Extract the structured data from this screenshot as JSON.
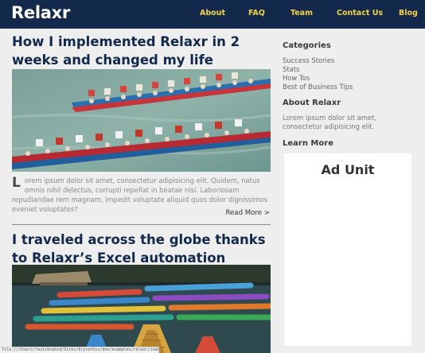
{
  "site": {
    "logo": "Relaxr"
  },
  "nav": {
    "items": [
      "About",
      "FAQ",
      "Team",
      "Contact Us",
      "Blog"
    ]
  },
  "posts": [
    {
      "title": "How I implemented Relaxr in 2 weeks and changed my life",
      "image": "dragon-boat-race-photo",
      "excerpt_first_letter": "L",
      "excerpt_rest": "orem ipsum dolor sit amet, consectetur adipisicing elit. Quidem, natus omnis nihil delectus, corrupti repellat in beatae nisi. Laboriosam repudiandae rem magnam, impedit voluptate aliquid quos dolor dignissimos eveniet voluptates?",
      "read_more": "Read More >"
    },
    {
      "title": "I traveled across the globe thanks to Relaxr’s Excel automation",
      "image": "colorful-boats-lake-photo"
    }
  ],
  "sidebar": {
    "categories_heading": "Categories",
    "categories": [
      "Success Stories",
      "Stats",
      "How Tos",
      "Best of Business Tips"
    ],
    "about_heading": "About Relaxr",
    "about_text": "Lorem ipsum dolor sit amet, consectetur adipisicing elit.",
    "learn_heading": "Learn More",
    "ad_label": "Ad Unit"
  },
  "status_bar": {
    "url": "file:///Users/ravishnahid/Sites/brycethis/dev/examples/relaxr/index.html#"
  },
  "colors": {
    "header_bg": "#13294b",
    "nav_link": "#f3d34a",
    "title": "#13294b",
    "page_bg": "#eeeeee"
  }
}
